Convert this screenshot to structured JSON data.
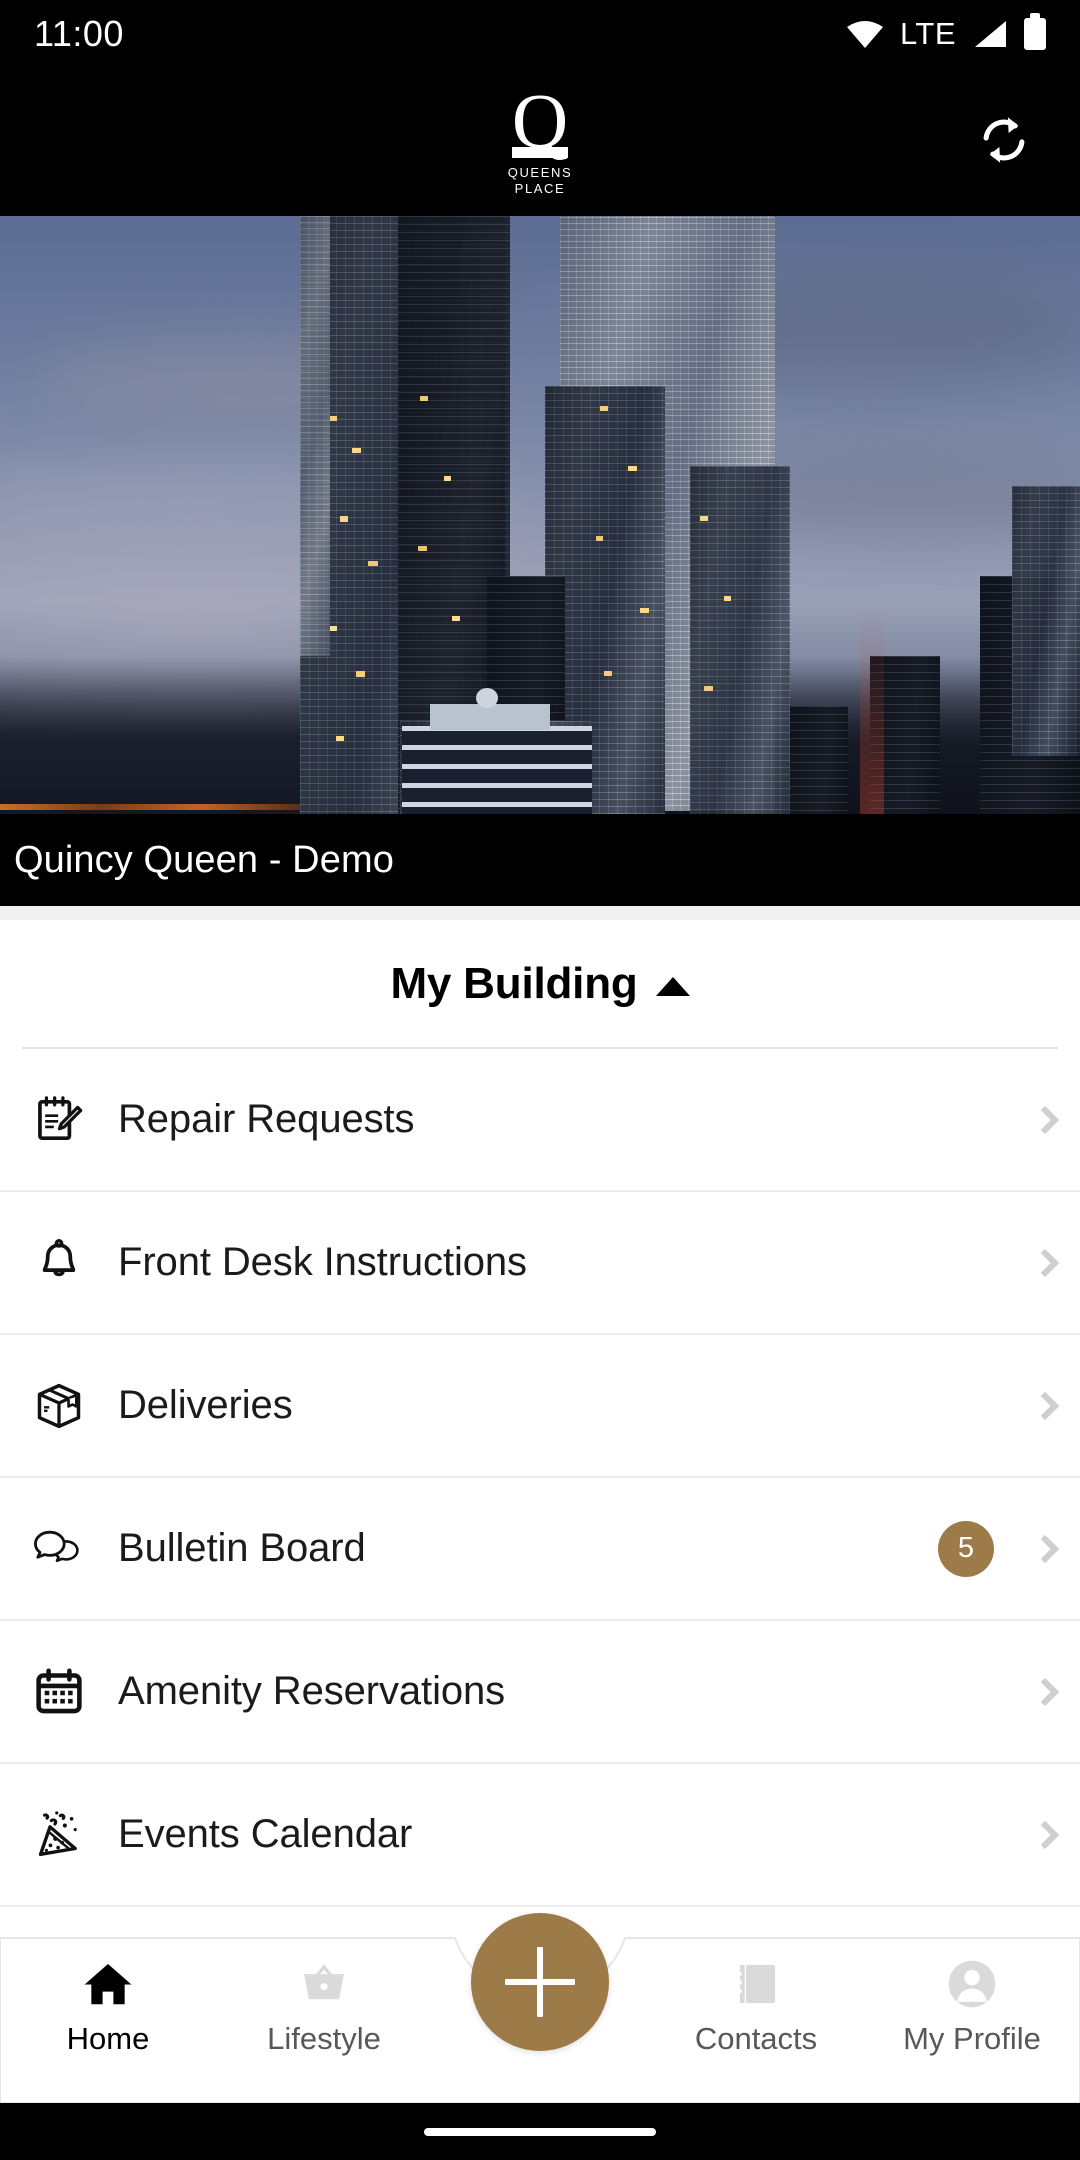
{
  "status_bar": {
    "time": "11:00",
    "network": "LTE",
    "icons": [
      "wifi-icon",
      "signal-icon",
      "battery-icon"
    ]
  },
  "app_bar": {
    "logo_letter": "Q",
    "logo_line1": "QUEENS",
    "logo_line2": "PLACE",
    "refresh_icon": "refresh-icon"
  },
  "hero": {
    "caption": "Quincy Queen - Demo",
    "alt": "Night skyline of glass residential towers"
  },
  "section": {
    "title": "My Building",
    "caret": "chevron-up-icon",
    "expanded": true
  },
  "menu": {
    "items": [
      {
        "label": "Repair Requests",
        "icon": "memo-icon",
        "badge": null
      },
      {
        "label": "Front Desk Instructions",
        "icon": "bell-icon",
        "badge": null
      },
      {
        "label": "Deliveries",
        "icon": "package-icon",
        "badge": null
      },
      {
        "label": "Bulletin Board",
        "icon": "speech-bubbles-icon",
        "badge": "5"
      },
      {
        "label": "Amenity Reservations",
        "icon": "calendar-icon",
        "badge": null
      },
      {
        "label": "Events Calendar",
        "icon": "party-popper-icon",
        "badge": null
      }
    ],
    "chevron_icon": "chevron-right-icon"
  },
  "bottom_nav": {
    "items": [
      {
        "label": "Home",
        "icon": "home-icon",
        "active": true
      },
      {
        "label": "Lifestyle",
        "icon": "basket-icon",
        "active": false
      },
      {
        "label": "Contacts",
        "icon": "contacts-icon",
        "active": false
      },
      {
        "label": "My Profile",
        "icon": "person-icon",
        "active": false
      }
    ],
    "fab": {
      "icon": "plus-icon",
      "label": "Add"
    }
  },
  "colors": {
    "accent_gold": "#9d7b48",
    "badge_gold": "#9d7b48",
    "header_bg": "#000000",
    "page_bg": "#ffffff",
    "divider": "#ededed",
    "chevron": "#cfcfcf",
    "nav_idle": "#58585a",
    "nav_active": "#000000"
  }
}
